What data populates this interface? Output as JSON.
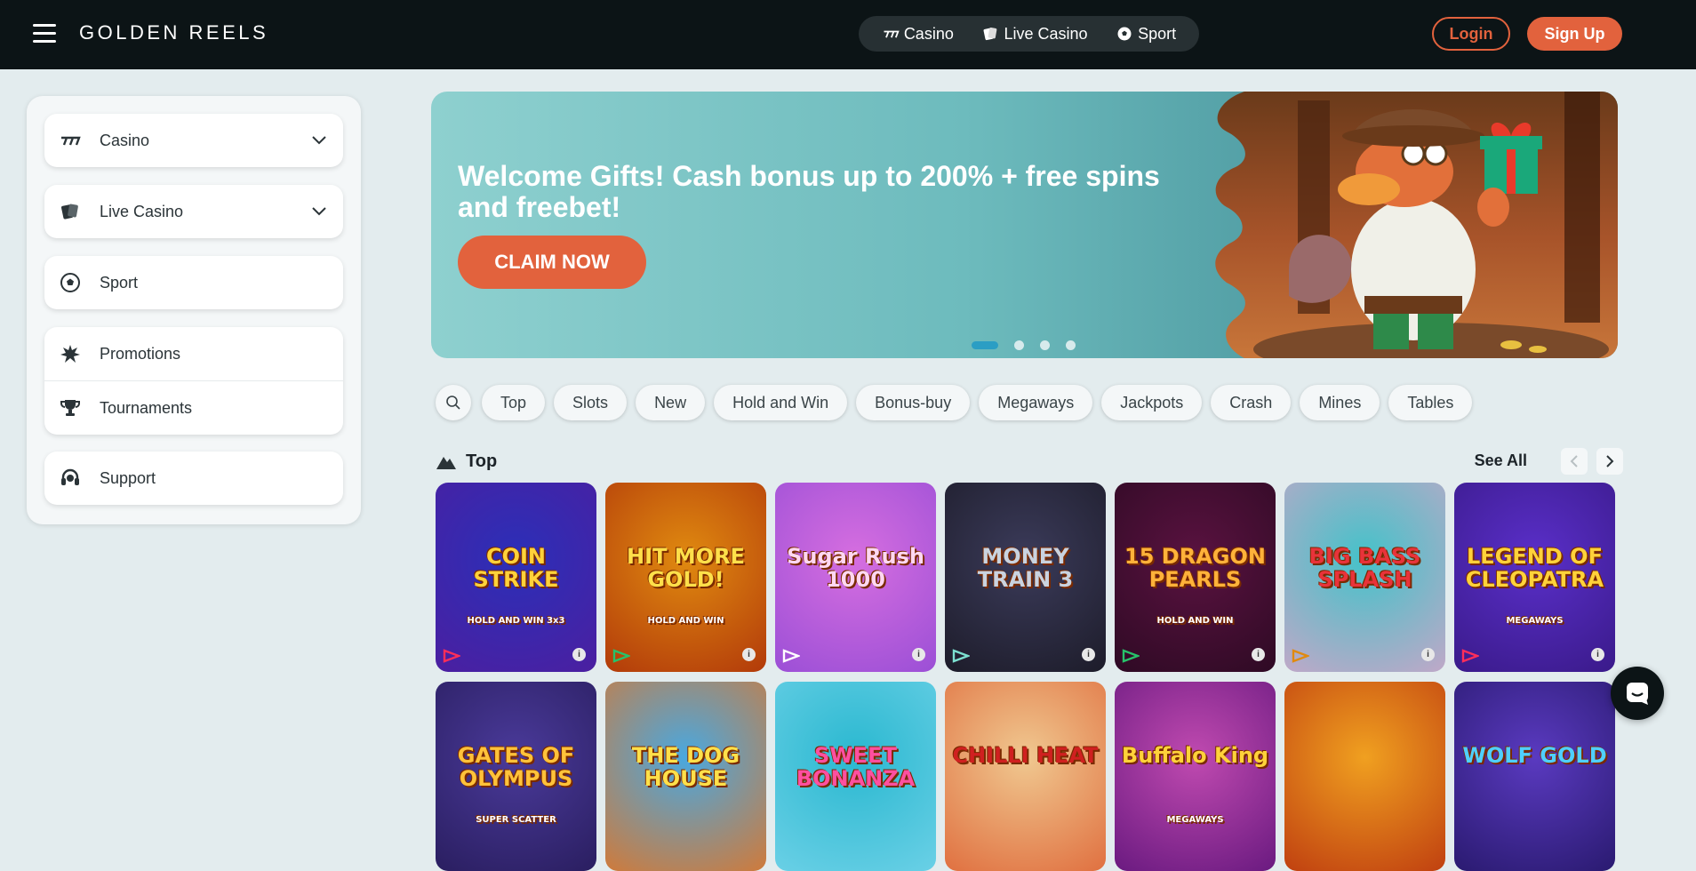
{
  "header": {
    "logo": "GOLDEN REELS",
    "nav": [
      {
        "label": "Casino",
        "icon": "casino-icon"
      },
      {
        "label": "Live Casino",
        "icon": "cards-icon"
      },
      {
        "label": "Sport",
        "icon": "soccer-ball-icon"
      }
    ],
    "login": "Login",
    "signup": "Sign Up"
  },
  "sidebar": {
    "items": [
      {
        "label": "Casino",
        "icon": "casino-icon",
        "expandable": true
      },
      {
        "label": "Live Casino",
        "icon": "cards-icon",
        "expandable": true
      },
      {
        "label": "Sport",
        "icon": "soccer-ball-icon"
      },
      {
        "label": "Promotions",
        "icon": "starburst-icon"
      },
      {
        "label": "Tournaments",
        "icon": "trophy-icon"
      },
      {
        "label": "Support",
        "icon": "headset-icon"
      }
    ]
  },
  "banner": {
    "title": "Welcome Gifts! Cash bonus up to 200% + free spins and freebet!",
    "cta": "CLAIM NOW",
    "slides": 4,
    "active_slide": 1
  },
  "filters": [
    "Top",
    "Slots",
    "New",
    "Hold and Win",
    "Bonus-buy",
    "Megaways",
    "Jackpots",
    "Crash",
    "Mines",
    "Tables"
  ],
  "section": {
    "title": "Top",
    "see_all": "See All"
  },
  "games": [
    {
      "name": "COIN STRIKE",
      "sub": "HOLD AND WIN 3x3",
      "bg": "#2b2fb8",
      "bg2": "#4b1fa0",
      "text": "#ffd23a",
      "prov": "#ff2e5a"
    },
    {
      "name": "HIT MORE GOLD!",
      "sub": "HOLD AND WIN",
      "bg": "#e08a10",
      "bg2": "#b23a0a",
      "text": "#ffe04a",
      "prov": "#27c26a"
    },
    {
      "name": "Sugar Rush 1000",
      "sub": "",
      "bg": "#d66ee0",
      "bg2": "#9b4fd6",
      "text": "#ffd7f2",
      "prov": "#ffffff"
    },
    {
      "name": "MONEY TRAIN 3",
      "sub": "",
      "bg": "#3b3b5a",
      "bg2": "#1d1c2a",
      "text": "#c9d3e0",
      "prov": "#7ce0d0"
    },
    {
      "name": "15 DRAGON PEARLS",
      "sub": "HOLD AND WIN",
      "bg": "#5a1240",
      "bg2": "#2e0a24",
      "text": "#ffb23a",
      "prov": "#27c26a"
    },
    {
      "name": "BIG BASS SPLASH",
      "sub": "",
      "bg": "#44c2c9",
      "bg2": "#c0a8c8",
      "text": "#e8333a",
      "prov": "#e08a10"
    },
    {
      "name": "LEGEND OF CLEOPATRA",
      "sub": "MEGAWAYS",
      "bg": "#5a2fc9",
      "bg2": "#3a1a8a",
      "text": "#ffd23a",
      "prov": "#ff2e5a"
    },
    {
      "name": "GATES OF OLYMPUS",
      "sub": "SUPER SCATTER",
      "bg": "#4a3a9a",
      "bg2": "#2a1e60",
      "text": "#ffc23a",
      "prov": "#ffffff"
    },
    {
      "name": "THE DOG HOUSE",
      "sub": "",
      "bg": "#49a8e0",
      "bg2": "#d07a3a",
      "text": "#ffe04a",
      "prov": "#ffffff"
    },
    {
      "name": "SWEET BONANZA",
      "sub": "",
      "bg": "#2ab8d0",
      "bg2": "#6ad0e6",
      "text": "#ff4fa0",
      "prov": "#ffffff"
    },
    {
      "name": "CHILLI HEAT",
      "sub": "",
      "bg": "#f0c890",
      "bg2": "#e07040",
      "text": "#d02020",
      "prov": "#ffffff"
    },
    {
      "name": "Buffalo King",
      "sub": "MEGAWAYS",
      "bg": "#c04ab0",
      "bg2": "#6a1a80",
      "text": "#ffd23a",
      "prov": "#ffffff"
    },
    {
      "name": "",
      "sub": "",
      "bg": "#f0a020",
      "bg2": "#c04010",
      "text": "#ffffff",
      "prov": "#ffffff"
    },
    {
      "name": "WOLF GOLD",
      "sub": "",
      "bg": "#5a3ac0",
      "bg2": "#2a1a70",
      "text": "#4fd0ff",
      "prov": "#ffffff"
    }
  ],
  "colors": {
    "accent": "#e2623d",
    "topbar": "#0c1416",
    "page_bg": "#e3ecee",
    "slider_active": "#2b9ec4"
  }
}
